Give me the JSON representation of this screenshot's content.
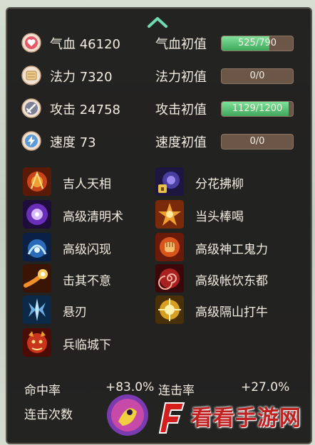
{
  "stats": [
    {
      "label": "气血 46120",
      "init_label": "气血初值",
      "bar_text": "525/790",
      "fill": 0.665,
      "icon": "heart-icon",
      "color": "#e35a6a"
    },
    {
      "label": "法力 7320",
      "init_label": "法力初值",
      "bar_text": "0/0",
      "fill": 0,
      "icon": "mana-icon",
      "color": "#e9c98a"
    },
    {
      "label": "攻击 24758",
      "init_label": "攻击初值",
      "bar_text": "1129/1200",
      "fill": 0.94,
      "icon": "sword-icon",
      "color": "#9aa1b8"
    },
    {
      "label": "速度 73",
      "init_label": "速度初值",
      "bar_text": "0/0",
      "fill": 0,
      "icon": "lightning-icon",
      "color": "#7fb6e8"
    }
  ],
  "skills": [
    {
      "name": "吉人天相",
      "icon": "fire-aura-icon",
      "color": "#c8461c"
    },
    {
      "name": "分花拂柳",
      "icon": "locked-scroll-icon",
      "color": "#4a3ea0"
    },
    {
      "name": "高级清明术",
      "icon": "purple-orb-icon",
      "color": "#8a4fd8"
    },
    {
      "name": "当头棒喝",
      "icon": "burst-icon",
      "color": "#e0802a"
    },
    {
      "name": "高级闪现",
      "icon": "blue-flash-icon",
      "color": "#3a8fd8"
    },
    {
      "name": "高级神工鬼力",
      "icon": "fist-icon",
      "color": "#d8561c"
    },
    {
      "name": "击其不意",
      "icon": "comet-icon",
      "color": "#e86a1a"
    },
    {
      "name": "高级帐饮东都",
      "icon": "red-spiral-icon",
      "color": "#c42a2a"
    },
    {
      "name": "悬刃",
      "icon": "ice-blade-icon",
      "color": "#5aa8e0"
    },
    {
      "name": "高级隔山打牛",
      "icon": "golden-burst-icon",
      "color": "#e0b42a"
    },
    {
      "name": "兵临城下",
      "icon": "demon-face-icon",
      "color": "#c8341c"
    }
  ],
  "bottom": {
    "hit_label": "命中率",
    "hit_value": "+83.0%",
    "combo_rate_label": "连击率",
    "combo_rate_value": "+27.0%",
    "combo_count_label": "连击次数"
  },
  "watermark": "看看手游网"
}
